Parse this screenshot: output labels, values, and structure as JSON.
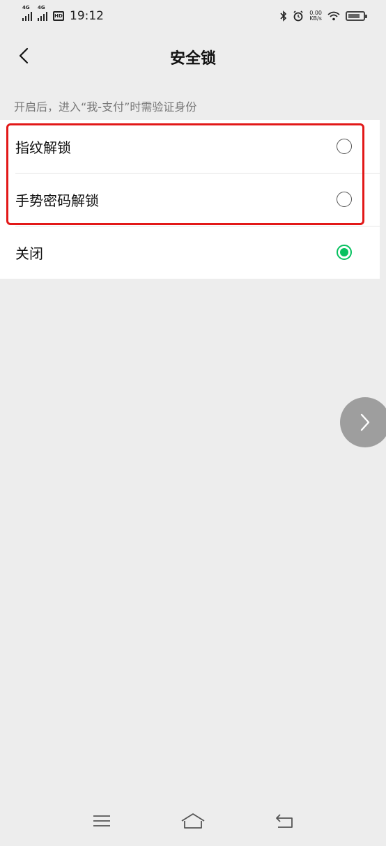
{
  "status_bar": {
    "network_1": "4G",
    "network_2": "4G",
    "chip_label": "HD",
    "time": "19:12",
    "speed_value": "0.00",
    "speed_unit": "KB/s"
  },
  "header": {
    "title": "安全锁"
  },
  "hint": "开启后，进入“我-支付”时需验证身份",
  "options": [
    {
      "label": "指纹解锁",
      "selected": false
    },
    {
      "label": "手势密码解锁",
      "selected": false
    },
    {
      "label": "关闭",
      "selected": true
    }
  ],
  "colors": {
    "accent": "#07c160",
    "highlight": "#e21818",
    "background": "#ededed"
  },
  "icons": {
    "back": "chevron-left-icon",
    "float": "chevron-right-icon",
    "nav_menu": "menu-icon",
    "nav_home": "home-icon",
    "nav_back": "back-icon"
  }
}
